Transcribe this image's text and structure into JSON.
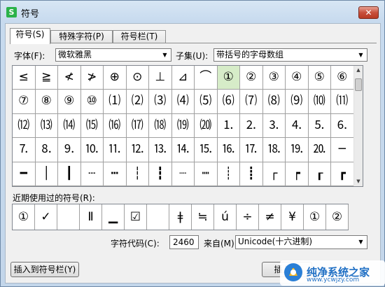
{
  "window": {
    "title": "符号",
    "app_icon": "S",
    "close_glyph": "✕"
  },
  "tabs": [
    "符号(S)",
    "特殊字符(P)",
    "符号栏(T)"
  ],
  "font": {
    "label": "字体(F):",
    "value": "微软雅黑"
  },
  "subset": {
    "label": "子集(U):",
    "value": "带括号的字母数组"
  },
  "symbols": [
    "≤",
    "≧",
    "≮",
    "≯",
    "⊕",
    "⊙",
    "⊥",
    "⊿",
    "⌒",
    "①",
    "②",
    "③",
    "④",
    "⑤",
    "⑥",
    "⑦",
    "⑧",
    "⑨",
    "⑩",
    "⑴",
    "⑵",
    "⑶",
    "⑷",
    "⑸",
    "⑹",
    "⑺",
    "⑻",
    "⑼",
    "⑽",
    "⑾",
    "⑿",
    "⒀",
    "⒁",
    "⒂",
    "⒃",
    "⒄",
    "⒅",
    "⒆",
    "⒇",
    "⒈",
    "⒉",
    "⒊",
    "⒋",
    "⒌",
    "⒍",
    "⒎",
    "⒏",
    "⒐",
    "⒑",
    "⒒",
    "⒓",
    "⒔",
    "⒕",
    "⒖",
    "⒗",
    "⒘",
    "⒙",
    "⒚",
    "⒛",
    "─",
    "━",
    "│",
    "┃",
    "┄",
    "┅",
    "┆",
    "┇",
    "┈",
    "┉",
    "┊",
    "┋",
    "┌",
    "┍",
    "┎",
    "┏"
  ],
  "selected_symbol": "①",
  "recent": {
    "label": "近期使用过的符号(R):",
    "items": [
      "①",
      "✓",
      "",
      "Ⅱ",
      "▁",
      "☑",
      "",
      "ǂ",
      "≒",
      "ú",
      "÷",
      "≠",
      "¥",
      "①",
      "②"
    ]
  },
  "char_code": {
    "label": "字符代码(C):",
    "value": "2460",
    "from_label": "来自(M)",
    "from_value": "Unicode(十六进制)"
  },
  "buttons": {
    "insert_to_bar": "插入到符号栏(Y)",
    "insert": "插入(I)"
  },
  "watermark": {
    "name": "纯净系统之家",
    "url": "www.ycwjzy.com"
  }
}
